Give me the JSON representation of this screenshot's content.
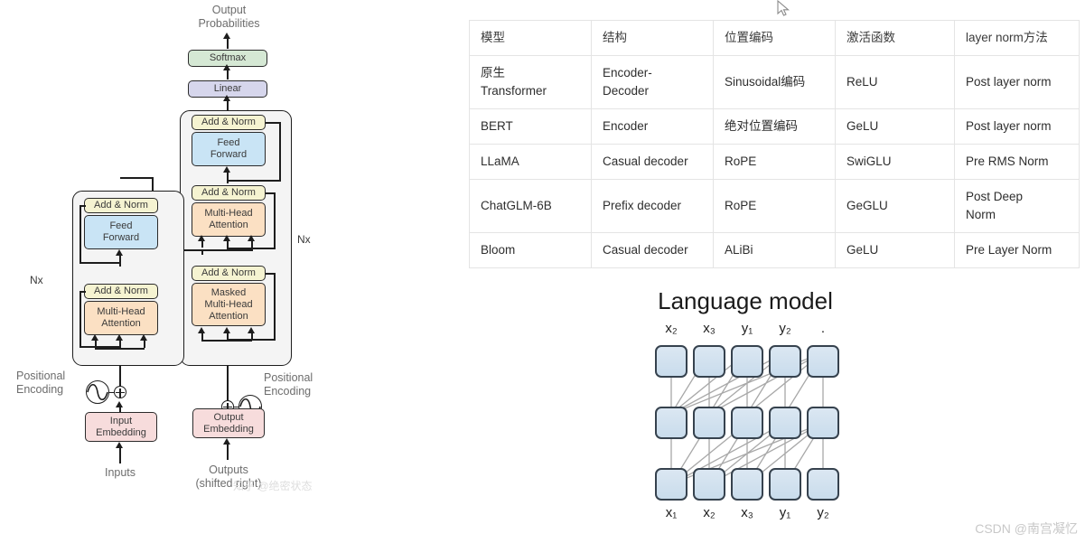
{
  "transformer": {
    "top_label": "Output\nProbabilities",
    "blocks": {
      "softmax": "Softmax",
      "linear": "Linear",
      "add_norm": "Add & Norm",
      "feed_forward": "Feed\nForward",
      "multi_head_attention": "Multi-Head\nAttention",
      "masked_multi_head_attention": "Masked\nMulti-Head\nAttention",
      "input_embedding": "Input\nEmbedding",
      "output_embedding": "Output\nEmbedding"
    },
    "labels": {
      "positional_encoding_left": "Positional\nEncoding",
      "positional_encoding_right": "Positional\nEncoding",
      "inputs": "Inputs",
      "outputs": "Outputs\n(shifted right)",
      "nx_encoder": "Nx",
      "nx_decoder": "Nx"
    },
    "colors": {
      "softmax": "#d5e8d4",
      "linear": "#d6d6ec",
      "add_norm": "#f5f3d1",
      "feed_forward": "#c9e4f5",
      "attention": "#fbe0c3",
      "embedding": "#f7dcdc",
      "stack_bg": "#f4f4f4",
      "stroke": "#1d1d1d",
      "label_text": "#6d6d6d"
    }
  },
  "table": {
    "headers": [
      "模型",
      "结构",
      "位置编码",
      "激活函数",
      "layer norm方法"
    ],
    "rows": [
      [
        "原生\nTransformer",
        "Encoder-\nDecoder",
        "Sinusoidal编码",
        "ReLU",
        "Post layer norm"
      ],
      [
        "BERT",
        "Encoder",
        "绝对位置编码",
        "GeLU",
        "Post layer norm"
      ],
      [
        "LLaMA",
        "Casual decoder",
        "RoPE",
        "SwiGLU",
        "Pre RMS Norm"
      ],
      [
        "ChatGLM-6B",
        "Prefix decoder",
        "RoPE",
        "GeGLU",
        "Post Deep\nNorm"
      ],
      [
        "Bloom",
        "Casual decoder",
        "ALiBi",
        "GeLU",
        "Pre Layer Norm"
      ]
    ]
  },
  "language_model": {
    "title": "Language model",
    "top_labels": [
      "x₂",
      "x₃",
      "y₁",
      "y₂",
      "."
    ],
    "bottom_labels": [
      "x₁",
      "x₂",
      "x₃",
      "y₁",
      "y₂"
    ],
    "rows": 3,
    "columns": 5,
    "node_color": "#cfe0ee",
    "node_border": "#36424e",
    "edge_color": "#a8a8a8"
  },
  "watermarks": {
    "csdn": "CSDN @南宫凝忆",
    "zhihu": "知乎 @绝密状态"
  }
}
